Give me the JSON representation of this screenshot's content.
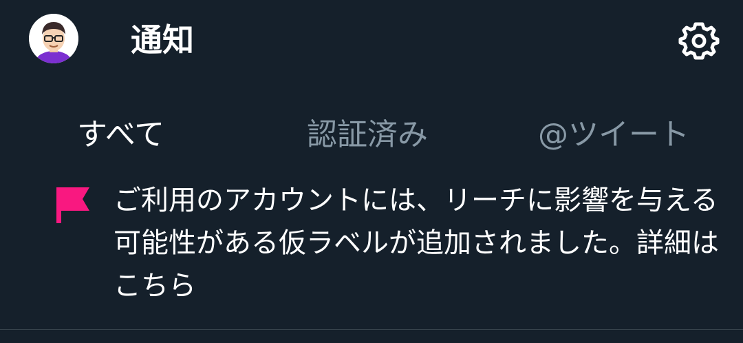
{
  "header": {
    "title": "通知",
    "avatar_icon": "user-avatar",
    "settings_icon": "gear-icon"
  },
  "tabs": [
    {
      "label": "すべて",
      "active": true
    },
    {
      "label": "認証済み",
      "active": false
    },
    {
      "label": "@ツイート",
      "active": false
    }
  ],
  "notification": {
    "icon": "flag-icon",
    "icon_color": "#f91880",
    "text": "ご利用のアカウントには、リーチに影響を与える可能性がある仮ラベルが追加されました。詳細はこちら"
  },
  "colors": {
    "background": "#15202b",
    "primary_text": "#ffffff",
    "secondary_text": "#8899a6",
    "accent": "#f91880"
  }
}
